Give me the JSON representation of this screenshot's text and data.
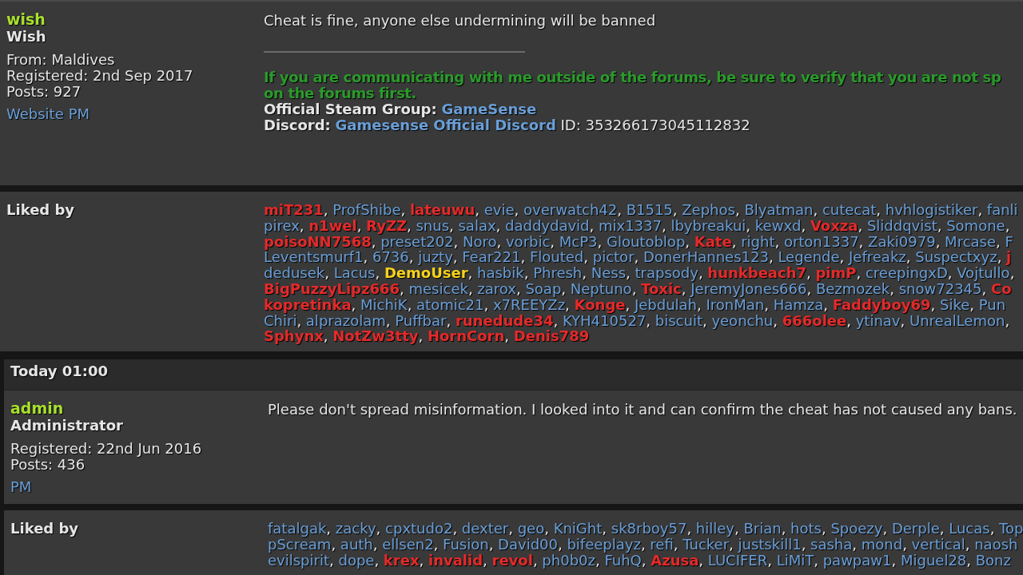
{
  "posts": [
    {
      "author": {
        "name": "wish",
        "rank": "Wish",
        "details": [
          "From: Maldives",
          "Registered: 2nd Sep 2017",
          "Posts: 927"
        ],
        "links": [
          "Website",
          "PM"
        ]
      },
      "message": "Cheat is fine, anyone else undermining will be banned",
      "signature": {
        "notice": [
          "If you are communicating with me outside of the forums, be sure to verify that you are not sp",
          "on the forums first."
        ],
        "lines": [
          {
            "label": "Official Steam Group:",
            "link": "GameSense"
          },
          {
            "label": "Discord:",
            "link": "Gamesense Official Discord",
            "suffix": "ID: 353266173045112832"
          }
        ]
      },
      "liked_by": {
        "label": "Liked by",
        "separator": ", ",
        "lines": [
          {
            "names": [
              {
                "name": "miT231",
                "color": "#e42a2a",
                "bold": true
              },
              {
                "name": "ProfShibe",
                "color": "#6a9fd8",
                "bold": false
              },
              {
                "name": "lateuwu",
                "color": "#e42a2a",
                "bold": true
              },
              {
                "name": "evie",
                "color": "#6a9fd8",
                "bold": false
              },
              {
                "name": "overwatch42",
                "color": "#6a9fd8",
                "bold": false
              },
              {
                "name": "B1515",
                "color": "#6a9fd8",
                "bold": false
              },
              {
                "name": "Zephos",
                "color": "#6a9fd8",
                "bold": false
              },
              {
                "name": "Blyatman",
                "color": "#6a9fd8",
                "bold": false
              },
              {
                "name": "cutecat",
                "color": "#6a9fd8",
                "bold": false
              },
              {
                "name": "hvhlogistiker",
                "color": "#6a9fd8",
                "bold": false
              },
              {
                "name": "fanli",
                "color": "#6a9fd8",
                "bold": false
              }
            ]
          },
          {
            "trailing": ",",
            "names": [
              {
                "name": "pirex",
                "color": "#6a9fd8",
                "bold": false
              },
              {
                "name": "n1wel",
                "color": "#e42a2a",
                "bold": true
              },
              {
                "name": "RyZZ",
                "color": "#e42a2a",
                "bold": true
              },
              {
                "name": "snus",
                "color": "#6a9fd8",
                "bold": false
              },
              {
                "name": "salax",
                "color": "#6a9fd8",
                "bold": false
              },
              {
                "name": "daddydavid",
                "color": "#6a9fd8",
                "bold": false
              },
              {
                "name": "mix1337",
                "color": "#6a9fd8",
                "bold": false
              },
              {
                "name": "lbybreakui",
                "color": "#6a9fd8",
                "bold": false
              },
              {
                "name": "kewxd",
                "color": "#6a9fd8",
                "bold": false
              },
              {
                "name": "Voxza",
                "color": "#e42a2a",
                "bold": true
              },
              {
                "name": "Sliddqvist",
                "color": "#6a9fd8",
                "bold": false
              },
              {
                "name": "Somone",
                "color": "#6a9fd8",
                "bold": false
              }
            ]
          },
          {
            "names": [
              {
                "name": "poisoNN7568",
                "color": "#e42a2a",
                "bold": true
              },
              {
                "name": "preset202",
                "color": "#6a9fd8",
                "bold": false
              },
              {
                "name": "Noro",
                "color": "#6a9fd8",
                "bold": false
              },
              {
                "name": "vorbic",
                "color": "#6a9fd8",
                "bold": false
              },
              {
                "name": "McP3",
                "color": "#6a9fd8",
                "bold": false
              },
              {
                "name": "Gloutoblop",
                "color": "#6a9fd8",
                "bold": false
              },
              {
                "name": "Kate",
                "color": "#e42a2a",
                "bold": true
              },
              {
                "name": "right",
                "color": "#6a9fd8",
                "bold": false
              },
              {
                "name": "orton1337",
                "color": "#6a9fd8",
                "bold": false
              },
              {
                "name": "Zaki0979",
                "color": "#6a9fd8",
                "bold": false
              },
              {
                "name": "Mrcase",
                "color": "#6a9fd8",
                "bold": false
              },
              {
                "name": "F",
                "color": "#6a9fd8",
                "bold": false
              }
            ]
          },
          {
            "names": [
              {
                "name": "Leventsmurf1",
                "color": "#6a9fd8",
                "bold": false
              },
              {
                "name": "6736",
                "color": "#6a9fd8",
                "bold": false
              },
              {
                "name": "juzty",
                "color": "#6a9fd8",
                "bold": false
              },
              {
                "name": "Fear221",
                "color": "#6a9fd8",
                "bold": false
              },
              {
                "name": "Flouted",
                "color": "#6a9fd8",
                "bold": false
              },
              {
                "name": "pictor",
                "color": "#6a9fd8",
                "bold": false
              },
              {
                "name": "DonerHannes123",
                "color": "#6a9fd8",
                "bold": false
              },
              {
                "name": "Legende",
                "color": "#6a9fd8",
                "bold": false
              },
              {
                "name": "Jefreakz",
                "color": "#6a9fd8",
                "bold": false
              },
              {
                "name": "Suspectxyz",
                "color": "#6a9fd8",
                "bold": false
              },
              {
                "name": "j",
                "color": "#e42a2a",
                "bold": true
              }
            ]
          },
          {
            "trailing": ",",
            "names": [
              {
                "name": "dedusek",
                "color": "#6a9fd8",
                "bold": false
              },
              {
                "name": "Lacus",
                "color": "#6a9fd8",
                "bold": false
              },
              {
                "name": "DemoUser",
                "color": "#f5d21c",
                "bold": true
              },
              {
                "name": "hasbik",
                "color": "#6a9fd8",
                "bold": false
              },
              {
                "name": "Phresh",
                "color": "#6a9fd8",
                "bold": false
              },
              {
                "name": "Ness",
                "color": "#6a9fd8",
                "bold": false
              },
              {
                "name": "trapsody",
                "color": "#6a9fd8",
                "bold": false
              },
              {
                "name": "hunkbeach7",
                "color": "#e42a2a",
                "bold": true
              },
              {
                "name": "pimP",
                "color": "#e42a2a",
                "bold": true
              },
              {
                "name": "creepingxD",
                "color": "#6a9fd8",
                "bold": false
              },
              {
                "name": "Vojtullo",
                "color": "#6a9fd8",
                "bold": false
              }
            ]
          },
          {
            "names": [
              {
                "name": "BigPuzzyLipz666",
                "color": "#e42a2a",
                "bold": true
              },
              {
                "name": "mesicek",
                "color": "#6a9fd8",
                "bold": false
              },
              {
                "name": "zarox",
                "color": "#6a9fd8",
                "bold": false
              },
              {
                "name": "Soap",
                "color": "#6a9fd8",
                "bold": false
              },
              {
                "name": "Neptuno",
                "color": "#6a9fd8",
                "bold": false
              },
              {
                "name": "Toxic",
                "color": "#e42a2a",
                "bold": true
              },
              {
                "name": "JeremyJones666",
                "color": "#6a9fd8",
                "bold": false
              },
              {
                "name": "Bezmozek",
                "color": "#6a9fd8",
                "bold": false
              },
              {
                "name": "snow72345",
                "color": "#6a9fd8",
                "bold": false
              },
              {
                "name": "Co",
                "color": "#e42a2a",
                "bold": true
              }
            ]
          },
          {
            "names": [
              {
                "name": "kopretinka",
                "color": "#e42a2a",
                "bold": true
              },
              {
                "name": "MichiK",
                "color": "#6a9fd8",
                "bold": false
              },
              {
                "name": "atomic21",
                "color": "#6a9fd8",
                "bold": false
              },
              {
                "name": "x7REEYZz",
                "color": "#6a9fd8",
                "bold": false
              },
              {
                "name": "Konge",
                "color": "#e42a2a",
                "bold": true
              },
              {
                "name": "Jebdulah",
                "color": "#6a9fd8",
                "bold": false
              },
              {
                "name": "IronMan",
                "color": "#6a9fd8",
                "bold": false
              },
              {
                "name": "Hamza",
                "color": "#6a9fd8",
                "bold": false
              },
              {
                "name": "Faddyboy69",
                "color": "#e42a2a",
                "bold": true
              },
              {
                "name": "Sike",
                "color": "#6a9fd8",
                "bold": false
              },
              {
                "name": "Pun",
                "color": "#6a9fd8",
                "bold": false
              }
            ]
          },
          {
            "trailing": ",",
            "names": [
              {
                "name": "Chiri",
                "color": "#6a9fd8",
                "bold": false
              },
              {
                "name": "alprazolam",
                "color": "#6a9fd8",
                "bold": false
              },
              {
                "name": "Puffbar",
                "color": "#6a9fd8",
                "bold": false
              },
              {
                "name": "runedude34",
                "color": "#e42a2a",
                "bold": true
              },
              {
                "name": "KYH410527",
                "color": "#6a9fd8",
                "bold": false
              },
              {
                "name": "biscuit",
                "color": "#6a9fd8",
                "bold": false
              },
              {
                "name": "yeonchu",
                "color": "#6a9fd8",
                "bold": false
              },
              {
                "name": "666olee",
                "color": "#e42a2a",
                "bold": true
              },
              {
                "name": "ytinav",
                "color": "#6a9fd8",
                "bold": false
              },
              {
                "name": "UnrealLemon",
                "color": "#6a9fd8",
                "bold": false
              }
            ]
          },
          {
            "names": [
              {
                "name": "Sphynx",
                "color": "#e42a2a",
                "bold": true
              },
              {
                "name": "NotZw3tty",
                "color": "#e42a2a",
                "bold": true
              },
              {
                "name": "HornCorn",
                "color": "#e42a2a",
                "bold": true
              },
              {
                "name": "Denis789",
                "color": "#e42a2a",
                "bold": true
              }
            ]
          }
        ]
      }
    },
    {
      "date": "Today 01:00",
      "author": {
        "name": "admin",
        "rank": "Administrator",
        "details": [
          "Registered: 22nd Jun 2016",
          "Posts: 436"
        ],
        "links": [
          "PM"
        ]
      },
      "message": "Please don't spread misinformation. I looked into it and can confirm the cheat has not caused any bans.",
      "liked_by": {
        "label": "Liked by",
        "separator": ", ",
        "lines": [
          {
            "names": [
              {
                "name": "fatalgak",
                "color": "#6a9fd8",
                "bold": false
              },
              {
                "name": "zacky",
                "color": "#6a9fd8",
                "bold": false
              },
              {
                "name": "cpxtudo2",
                "color": "#6a9fd8",
                "bold": false
              },
              {
                "name": "dexter",
                "color": "#6a9fd8",
                "bold": false
              },
              {
                "name": "geo",
                "color": "#6a9fd8",
                "bold": false
              },
              {
                "name": "KniGht",
                "color": "#6a9fd8",
                "bold": false
              },
              {
                "name": "sk8rboy57",
                "color": "#6a9fd8",
                "bold": false
              },
              {
                "name": "hilley",
                "color": "#6a9fd8",
                "bold": false
              },
              {
                "name": "Brian",
                "color": "#6a9fd8",
                "bold": false
              },
              {
                "name": "hots",
                "color": "#6a9fd8",
                "bold": false
              },
              {
                "name": "Spoezy",
                "color": "#6a9fd8",
                "bold": false
              },
              {
                "name": "Derple",
                "color": "#6a9fd8",
                "bold": false
              },
              {
                "name": "Lucas",
                "color": "#6a9fd8",
                "bold": false
              },
              {
                "name": "Top",
                "color": "#6a9fd8",
                "bold": false
              }
            ]
          },
          {
            "names": [
              {
                "name": "pScream",
                "color": "#6a9fd8",
                "bold": false
              },
              {
                "name": "auth",
                "color": "#6a9fd8",
                "bold": false
              },
              {
                "name": "ellsen2",
                "color": "#6a9fd8",
                "bold": false
              },
              {
                "name": "Fusion",
                "color": "#6a9fd8",
                "bold": false
              },
              {
                "name": "David00",
                "color": "#6a9fd8",
                "bold": false
              },
              {
                "name": "bifeeplayz",
                "color": "#6a9fd8",
                "bold": false
              },
              {
                "name": "refi",
                "color": "#6a9fd8",
                "bold": false
              },
              {
                "name": "Tucker",
                "color": "#6a9fd8",
                "bold": false
              },
              {
                "name": "justskill1",
                "color": "#6a9fd8",
                "bold": false
              },
              {
                "name": "sasha",
                "color": "#6a9fd8",
                "bold": false
              },
              {
                "name": "mond",
                "color": "#6a9fd8",
                "bold": false
              },
              {
                "name": "vertical",
                "color": "#6a9fd8",
                "bold": false
              },
              {
                "name": "naosh",
                "color": "#6a9fd8",
                "bold": false
              }
            ]
          },
          {
            "names": [
              {
                "name": "evilspirit",
                "color": "#6a9fd8",
                "bold": false
              },
              {
                "name": "dope",
                "color": "#6a9fd8",
                "bold": false
              },
              {
                "name": "krex",
                "color": "#e42a2a",
                "bold": true
              },
              {
                "name": "invalid",
                "color": "#e42a2a",
                "bold": true
              },
              {
                "name": "revol",
                "color": "#e42a2a",
                "bold": true
              },
              {
                "name": "ph0b0z",
                "color": "#6a9fd8",
                "bold": false
              },
              {
                "name": "FuhQ",
                "color": "#6a9fd8",
                "bold": false
              },
              {
                "name": "Azusa",
                "color": "#e42a2a",
                "bold": true
              },
              {
                "name": "LUCIFER",
                "color": "#6a9fd8",
                "bold": false
              },
              {
                "name": "LiMiT",
                "color": "#6a9fd8",
                "bold": false
              },
              {
                "name": "pawpaw1",
                "color": "#6a9fd8",
                "bold": false
              },
              {
                "name": "Miguel28",
                "color": "#6a9fd8",
                "bold": false
              },
              {
                "name": "Bonz",
                "color": "#6a9fd8",
                "bold": false
              }
            ]
          }
        ]
      }
    }
  ]
}
